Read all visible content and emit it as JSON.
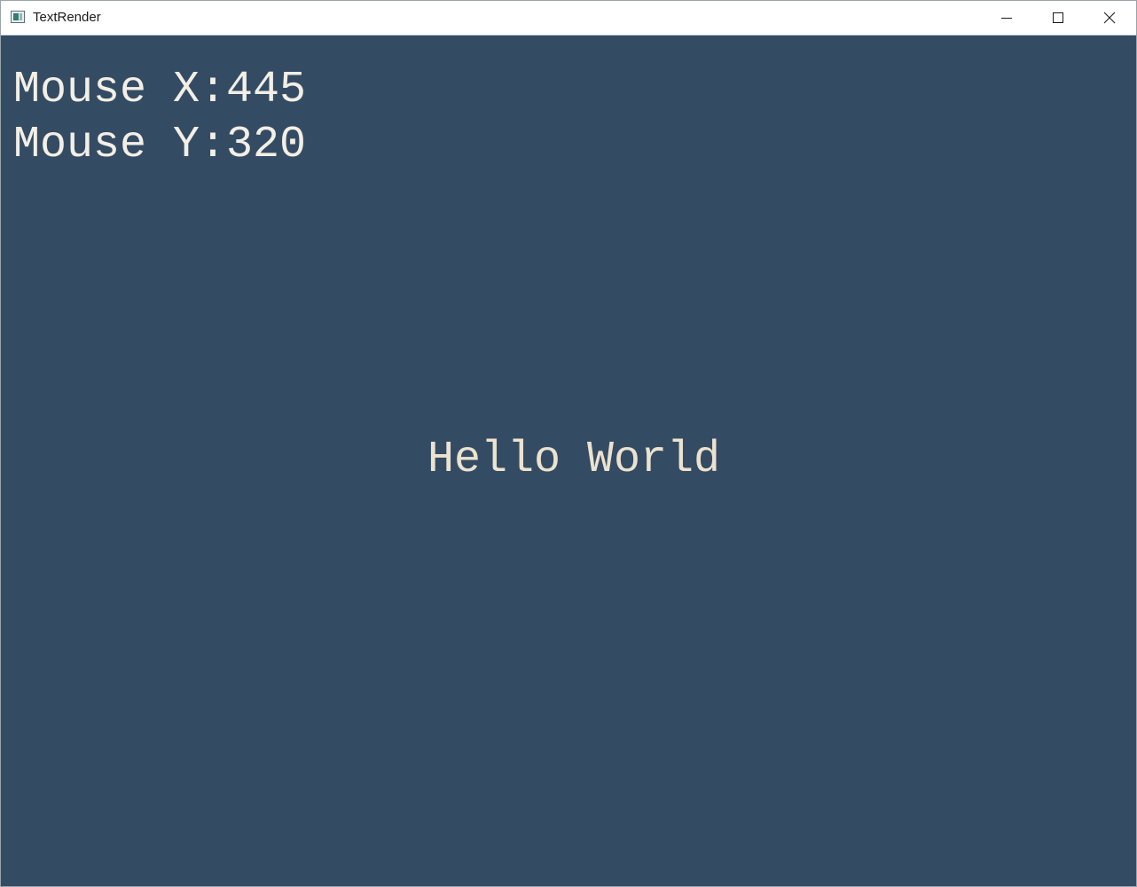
{
  "window": {
    "title": "TextRender",
    "app_icon": "app-window-icon",
    "controls": {
      "minimize_icon": "minimize-icon",
      "maximize_icon": "maximize-icon",
      "close_icon": "close-icon"
    }
  },
  "canvas": {
    "background_color": "#344c63",
    "text_color": "#f3efe6",
    "mouse_x_label": "Mouse X:",
    "mouse_x_value": "445",
    "mouse_y_label": "Mouse Y:",
    "mouse_y_value": "320",
    "center_text": "Hello World"
  }
}
